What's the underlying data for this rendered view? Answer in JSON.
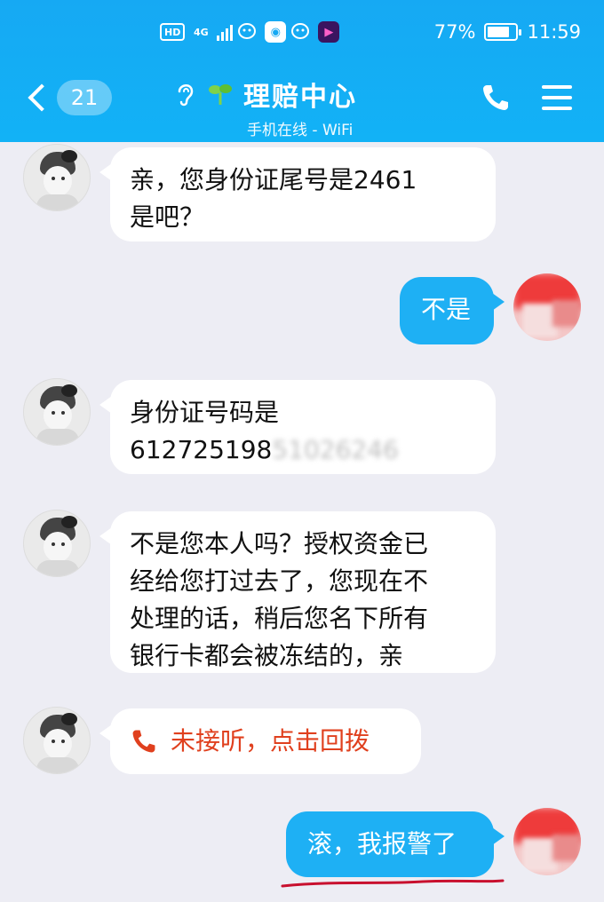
{
  "status_bar": {
    "hd": "HD",
    "network": "4G",
    "battery_percent": "77%",
    "battery_level": 0.77,
    "time": "11:59"
  },
  "header": {
    "unread_count": "21",
    "title": "理赔中心",
    "subtitle": "手机在线 - WiFi",
    "colors": {
      "bar": "#16a9f3"
    }
  },
  "messages": [
    {
      "side": "left",
      "lines": [
        "亲，您身份证尾号是2461",
        "是吧？"
      ]
    },
    {
      "side": "right",
      "text": "不是"
    },
    {
      "side": "left",
      "line1": "身份证号码是",
      "line2_visible": "612725198",
      "line2_blurred": "51026246"
    },
    {
      "side": "left",
      "lines": [
        "不是您本人吗？授权资金已",
        "经给您打过去了，您现在不",
        "处理的话，稍后您名下所有",
        "银行卡都会被冻结的，亲"
      ]
    },
    {
      "side": "left",
      "type": "missed-call",
      "text": "未接听，点击回拨"
    },
    {
      "side": "right",
      "text": "滚，我报警了"
    }
  ],
  "icons": {
    "back": "chevron-left-icon",
    "ear": "ear-icon",
    "sprout": "sprout-icon",
    "call": "phone-icon",
    "menu": "menu-icon",
    "missed_call": "phone-red-icon"
  },
  "colors": {
    "accent": "#1eb0f4",
    "missed_call_text": "#e0401e",
    "background": "#ededf4",
    "underline": "#c8102e"
  }
}
